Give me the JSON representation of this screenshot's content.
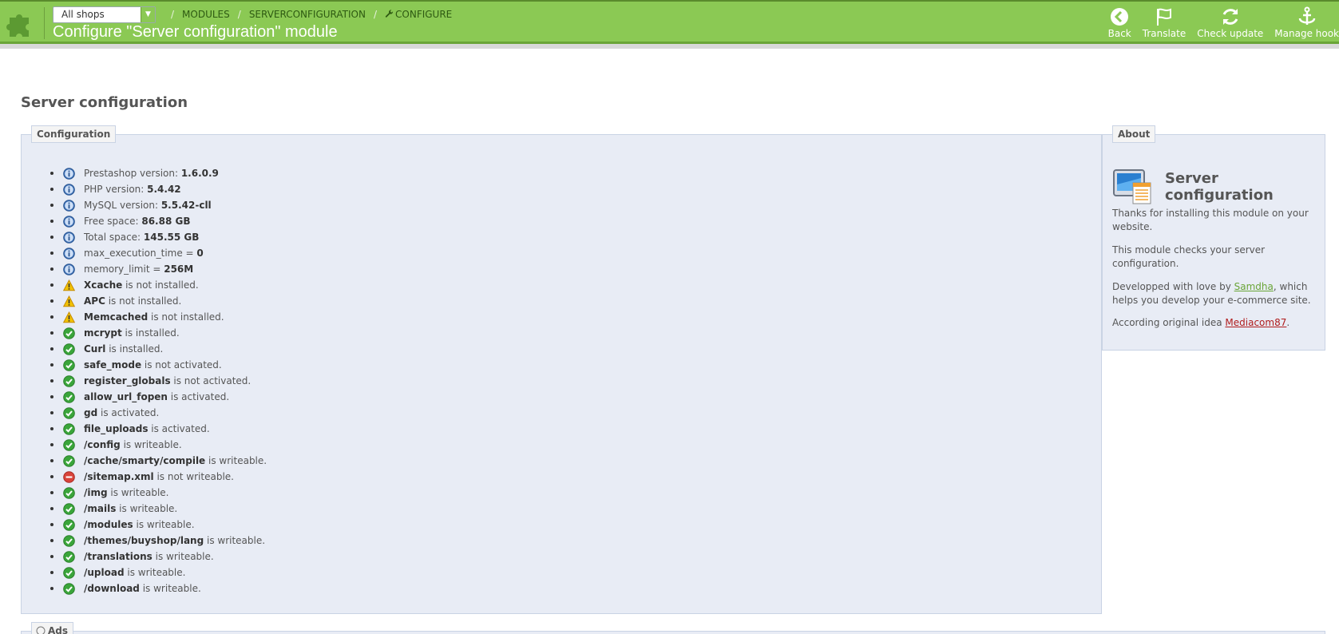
{
  "header": {
    "shop_select": "All shops",
    "breadcrumb": [
      "MODULES",
      "SERVERCONFIGURATION",
      "CONFIGURE"
    ],
    "title": "Configure \"Server configuration\" module",
    "toolbar": [
      {
        "label": "Back",
        "icon": "back-icon"
      },
      {
        "label": "Translate",
        "icon": "flag-icon"
      },
      {
        "label": "Check update",
        "icon": "refresh-icon"
      },
      {
        "label": "Manage hook",
        "icon": "anchor-icon"
      }
    ]
  },
  "main": {
    "section_title": "Server configuration",
    "config_legend": "Configuration",
    "checks": [
      {
        "status": "info",
        "pre": "Prestashop version: ",
        "bold": "1.6.0.9",
        "post": ""
      },
      {
        "status": "info",
        "pre": "PHP version: ",
        "bold": "5.4.42",
        "post": ""
      },
      {
        "status": "info",
        "pre": "MySQL version: ",
        "bold": "5.5.42-cll",
        "post": ""
      },
      {
        "status": "info",
        "pre": "Free space: ",
        "bold": "86.88 GB",
        "post": ""
      },
      {
        "status": "info",
        "pre": "Total space: ",
        "bold": "145.55 GB",
        "post": ""
      },
      {
        "status": "info",
        "pre": "max_execution_time = ",
        "bold": "0",
        "post": ""
      },
      {
        "status": "info",
        "pre": "memory_limit = ",
        "bold": "256M",
        "post": ""
      },
      {
        "status": "warning",
        "pre": "",
        "bold": "Xcache",
        "post": " is not installed."
      },
      {
        "status": "warning",
        "pre": "",
        "bold": "APC",
        "post": " is not installed."
      },
      {
        "status": "warning",
        "pre": "",
        "bold": "Memcached",
        "post": " is not installed."
      },
      {
        "status": "ok",
        "pre": "",
        "bold": "mcrypt",
        "post": " is installed."
      },
      {
        "status": "ok",
        "pre": "",
        "bold": "Curl",
        "post": " is installed."
      },
      {
        "status": "ok",
        "pre": "",
        "bold": "safe_mode",
        "post": " is not activated."
      },
      {
        "status": "ok",
        "pre": "",
        "bold": "register_globals",
        "post": " is not activated."
      },
      {
        "status": "ok",
        "pre": "",
        "bold": "allow_url_fopen",
        "post": " is activated."
      },
      {
        "status": "ok",
        "pre": "",
        "bold": "gd",
        "post": " is activated."
      },
      {
        "status": "ok",
        "pre": "",
        "bold": "file_uploads",
        "post": " is activated."
      },
      {
        "status": "ok",
        "pre": "",
        "bold": "/config",
        "post": " is writeable."
      },
      {
        "status": "ok",
        "pre": "",
        "bold": "/cache/smarty/compile",
        "post": " is writeable."
      },
      {
        "status": "error",
        "pre": "",
        "bold": "/sitemap.xml",
        "post": " is not writeable."
      },
      {
        "status": "ok",
        "pre": "",
        "bold": "/img",
        "post": " is writeable."
      },
      {
        "status": "ok",
        "pre": "",
        "bold": "/mails",
        "post": " is writeable."
      },
      {
        "status": "ok",
        "pre": "",
        "bold": "/modules",
        "post": " is writeable."
      },
      {
        "status": "ok",
        "pre": "",
        "bold": "/themes/buyshop/lang",
        "post": " is writeable."
      },
      {
        "status": "ok",
        "pre": "",
        "bold": "/translations",
        "post": " is writeable."
      },
      {
        "status": "ok",
        "pre": "",
        "bold": "/upload",
        "post": " is writeable."
      },
      {
        "status": "ok",
        "pre": "",
        "bold": "/download",
        "post": " is writeable."
      }
    ],
    "ads_legend": "Ads"
  },
  "about": {
    "legend": "About",
    "title": "Server configuration",
    "p1": "Thanks for installing this module on your website.",
    "p2": "This module checks your server configuration.",
    "p3_pre": "Developped with love by ",
    "p3_link": "Samdha",
    "p3_post": ", which helps you develop your e-commerce site.",
    "p4_pre": "According original idea ",
    "p4_link": "Mediacom87",
    "p4_post": "."
  },
  "colors": {
    "header_green": "#8bc954",
    "panel_bg": "#e8ecf5",
    "ok_green": "#3aa53a",
    "warning_yellow": "#f2c200",
    "error_red": "#d9433a",
    "info_blue": "#3b6fb6"
  }
}
